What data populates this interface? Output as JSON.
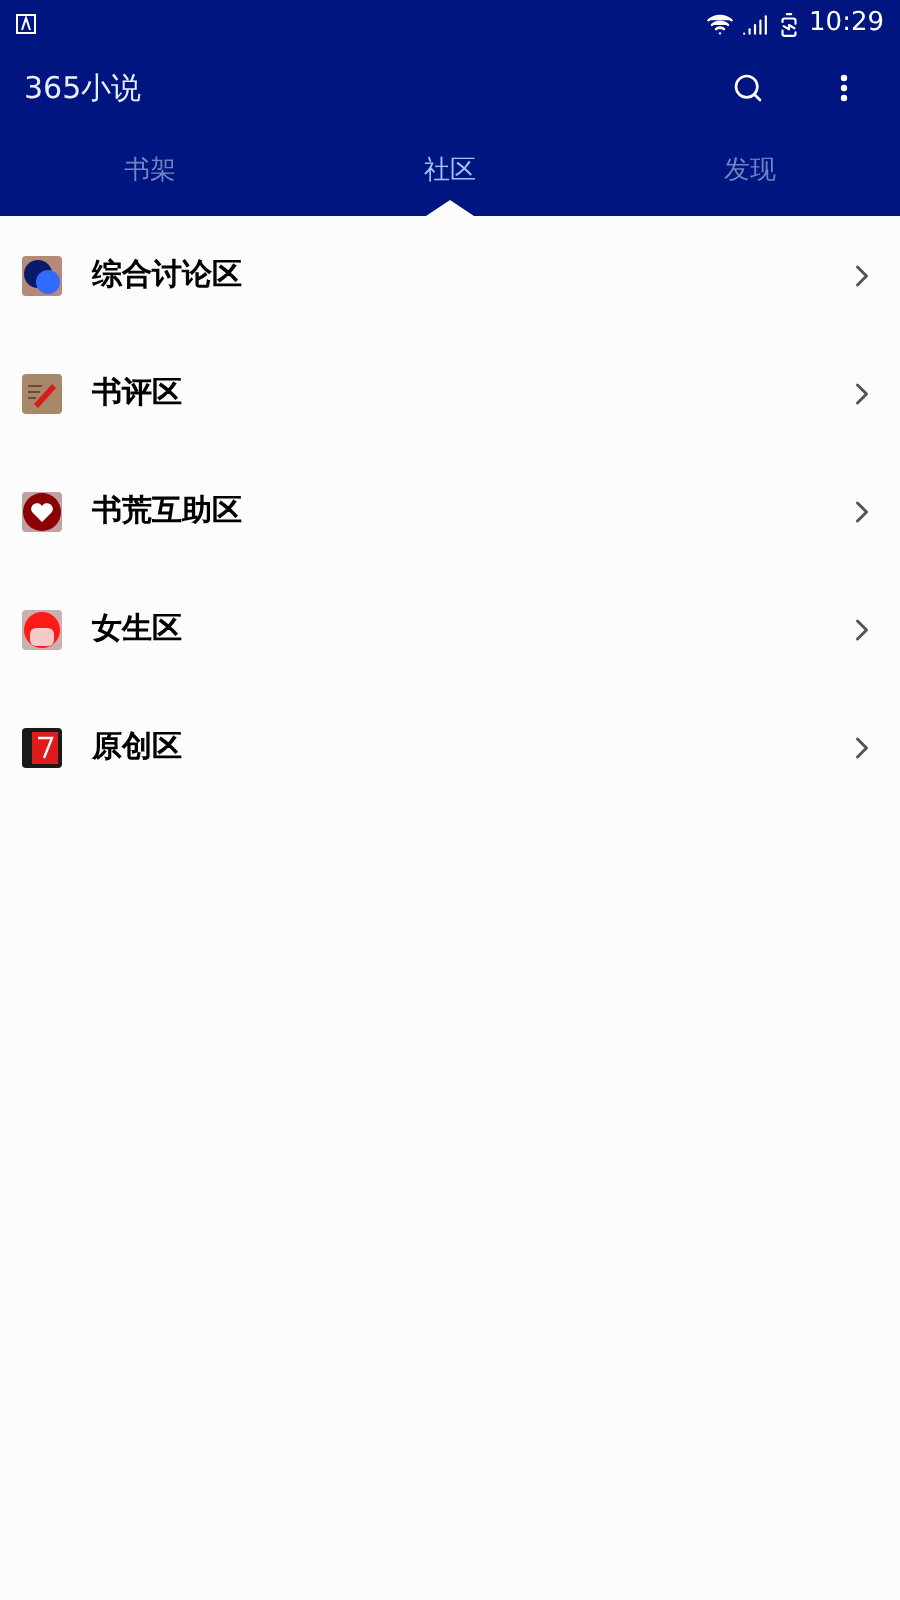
{
  "status_bar": {
    "time": "10:29"
  },
  "app_bar": {
    "title": "365小说"
  },
  "tabs": [
    {
      "label": "书架",
      "selected": false
    },
    {
      "label": "社区",
      "selected": true
    },
    {
      "label": "发现",
      "selected": false
    }
  ],
  "forums": [
    {
      "label": "综合讨论区",
      "kind": "chat"
    },
    {
      "label": "书评区",
      "kind": "review"
    },
    {
      "label": "书荒互助区",
      "kind": "heart"
    },
    {
      "label": "女生区",
      "kind": "girl"
    },
    {
      "label": "原创区",
      "kind": "original"
    }
  ]
}
